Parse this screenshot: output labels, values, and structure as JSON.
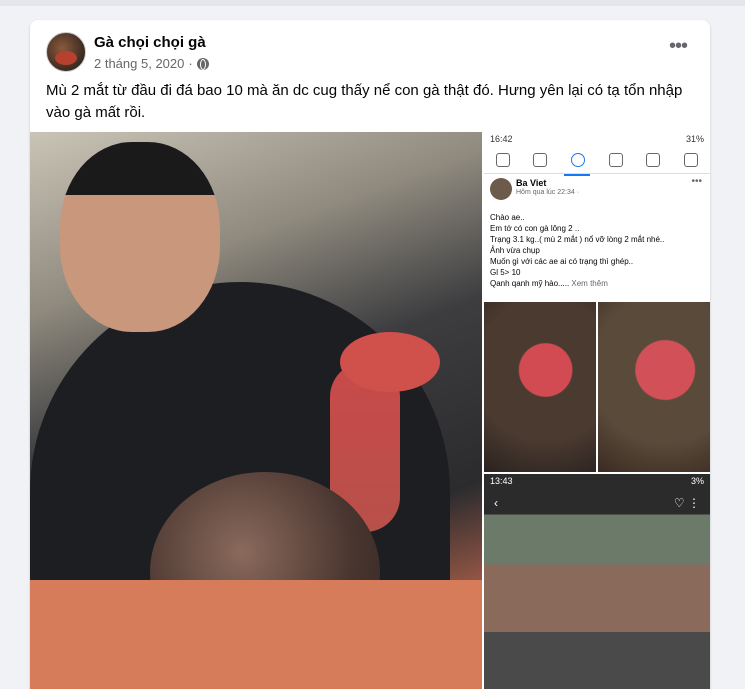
{
  "post": {
    "author": "Gà chọi chọi gà",
    "date": "2 tháng 5, 2020",
    "separator": "·",
    "more_label": "•••",
    "text": "Mù 2 mắt từ đầu đi  đá bao 10 mà ăn dc cug thấy nể con gà thật đó. Hưng yên lại có tạ tổn nhập vào gà mất rồi."
  },
  "screenshot": {
    "status_time": "16:42",
    "status_right": "31%",
    "inner_author": "Ba Viet",
    "inner_meta": "Hôm qua lúc 22:34 ·",
    "inner_more": "•••",
    "lines": [
      "Chào ae..",
      "Em tớ có con gà lông 2 ..",
      "Trạng 3.1 kg..( mù 2 mắt ) nổ vỡ lòng 2 mắt nhé..",
      "Ảnh vừa chụp",
      "Muốn gì với các ae ai có trạng thì ghép..",
      "Gl 5> 10"
    ],
    "last_line": "Qanh qanh mỹ hào.....",
    "see_more": " Xem thêm",
    "video_time": "13:43",
    "video_battery": "3%"
  },
  "colors": {
    "accent": "#1877f2",
    "text_secondary": "#65676b"
  }
}
